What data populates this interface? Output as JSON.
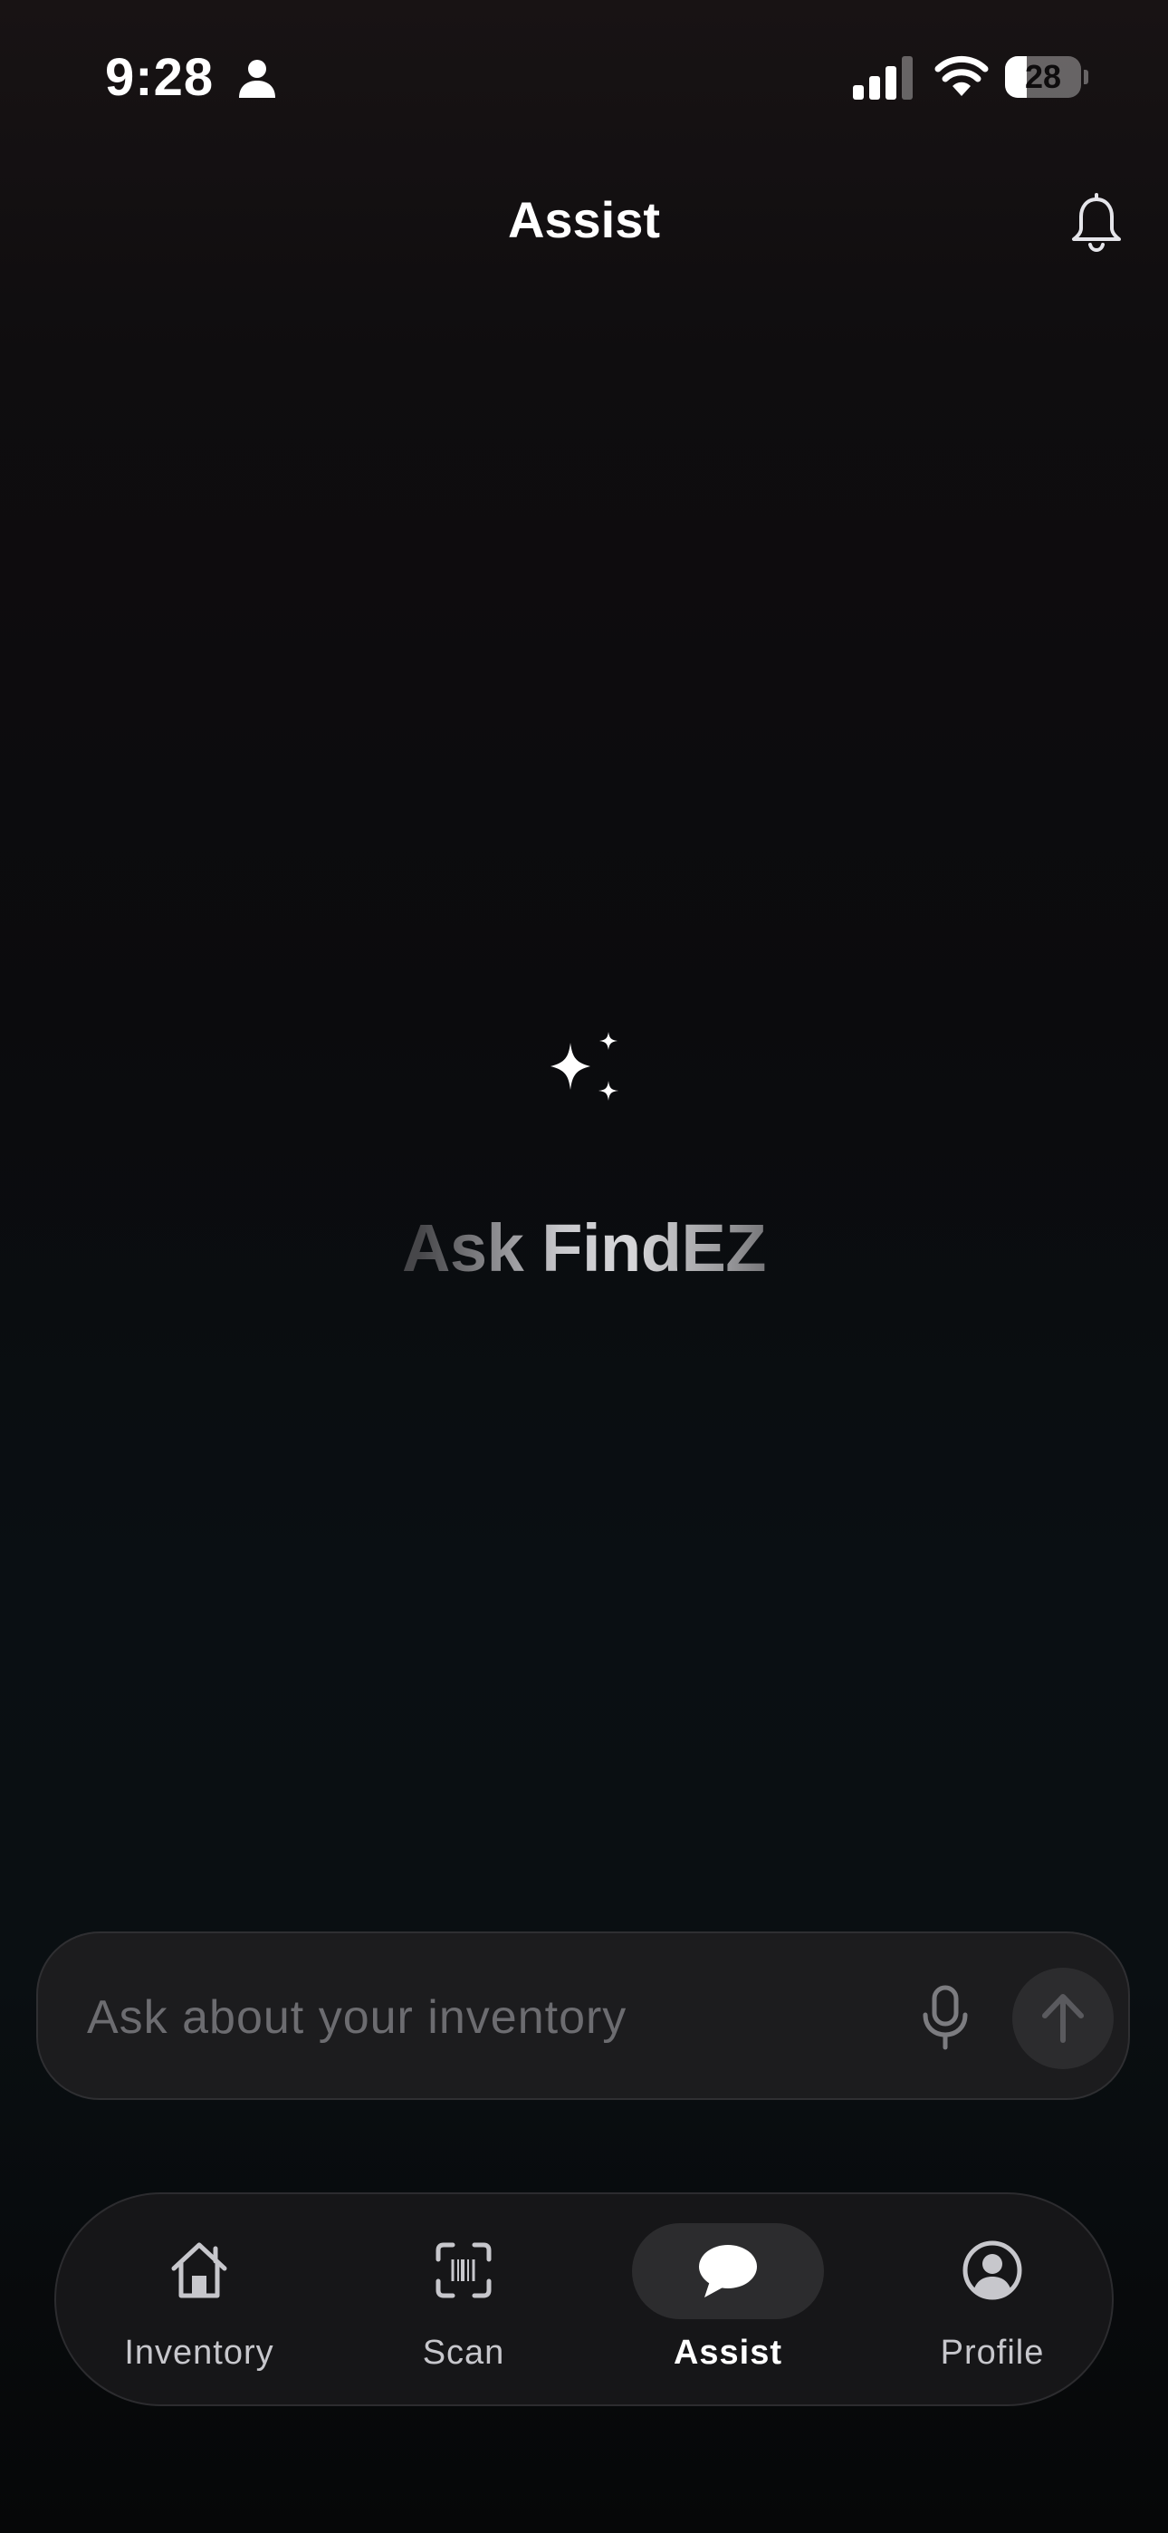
{
  "status_bar": {
    "time": "9:28",
    "battery_level": "28",
    "icons": [
      "person-icon",
      "cellular-signal-icon",
      "wifi-icon",
      "battery-icon"
    ]
  },
  "header": {
    "title": "Assist",
    "notification_icon": "bell-icon"
  },
  "hero": {
    "icon": "sparkles-icon",
    "title": "Ask FindEZ"
  },
  "chat_input": {
    "placeholder": "Ask about your inventory",
    "value": "",
    "mic_icon": "microphone-icon",
    "send_icon": "arrow-up-icon"
  },
  "tab_bar": {
    "active": "Assist",
    "tabs": [
      {
        "label": "Inventory",
        "icon": "house-icon"
      },
      {
        "label": "Scan",
        "icon": "barcode-scan-icon"
      },
      {
        "label": "Assist",
        "icon": "chat-bubble-icon"
      },
      {
        "label": "Profile",
        "icon": "person-circle-icon"
      }
    ]
  },
  "colors": {
    "background_top": "#181314",
    "background_mid": "#0a0f13",
    "input_background": "#1c1c1e",
    "tab_bar_background": "#161618",
    "active_pill": "#2c2c2e",
    "placeholder": "#6c6c70"
  }
}
